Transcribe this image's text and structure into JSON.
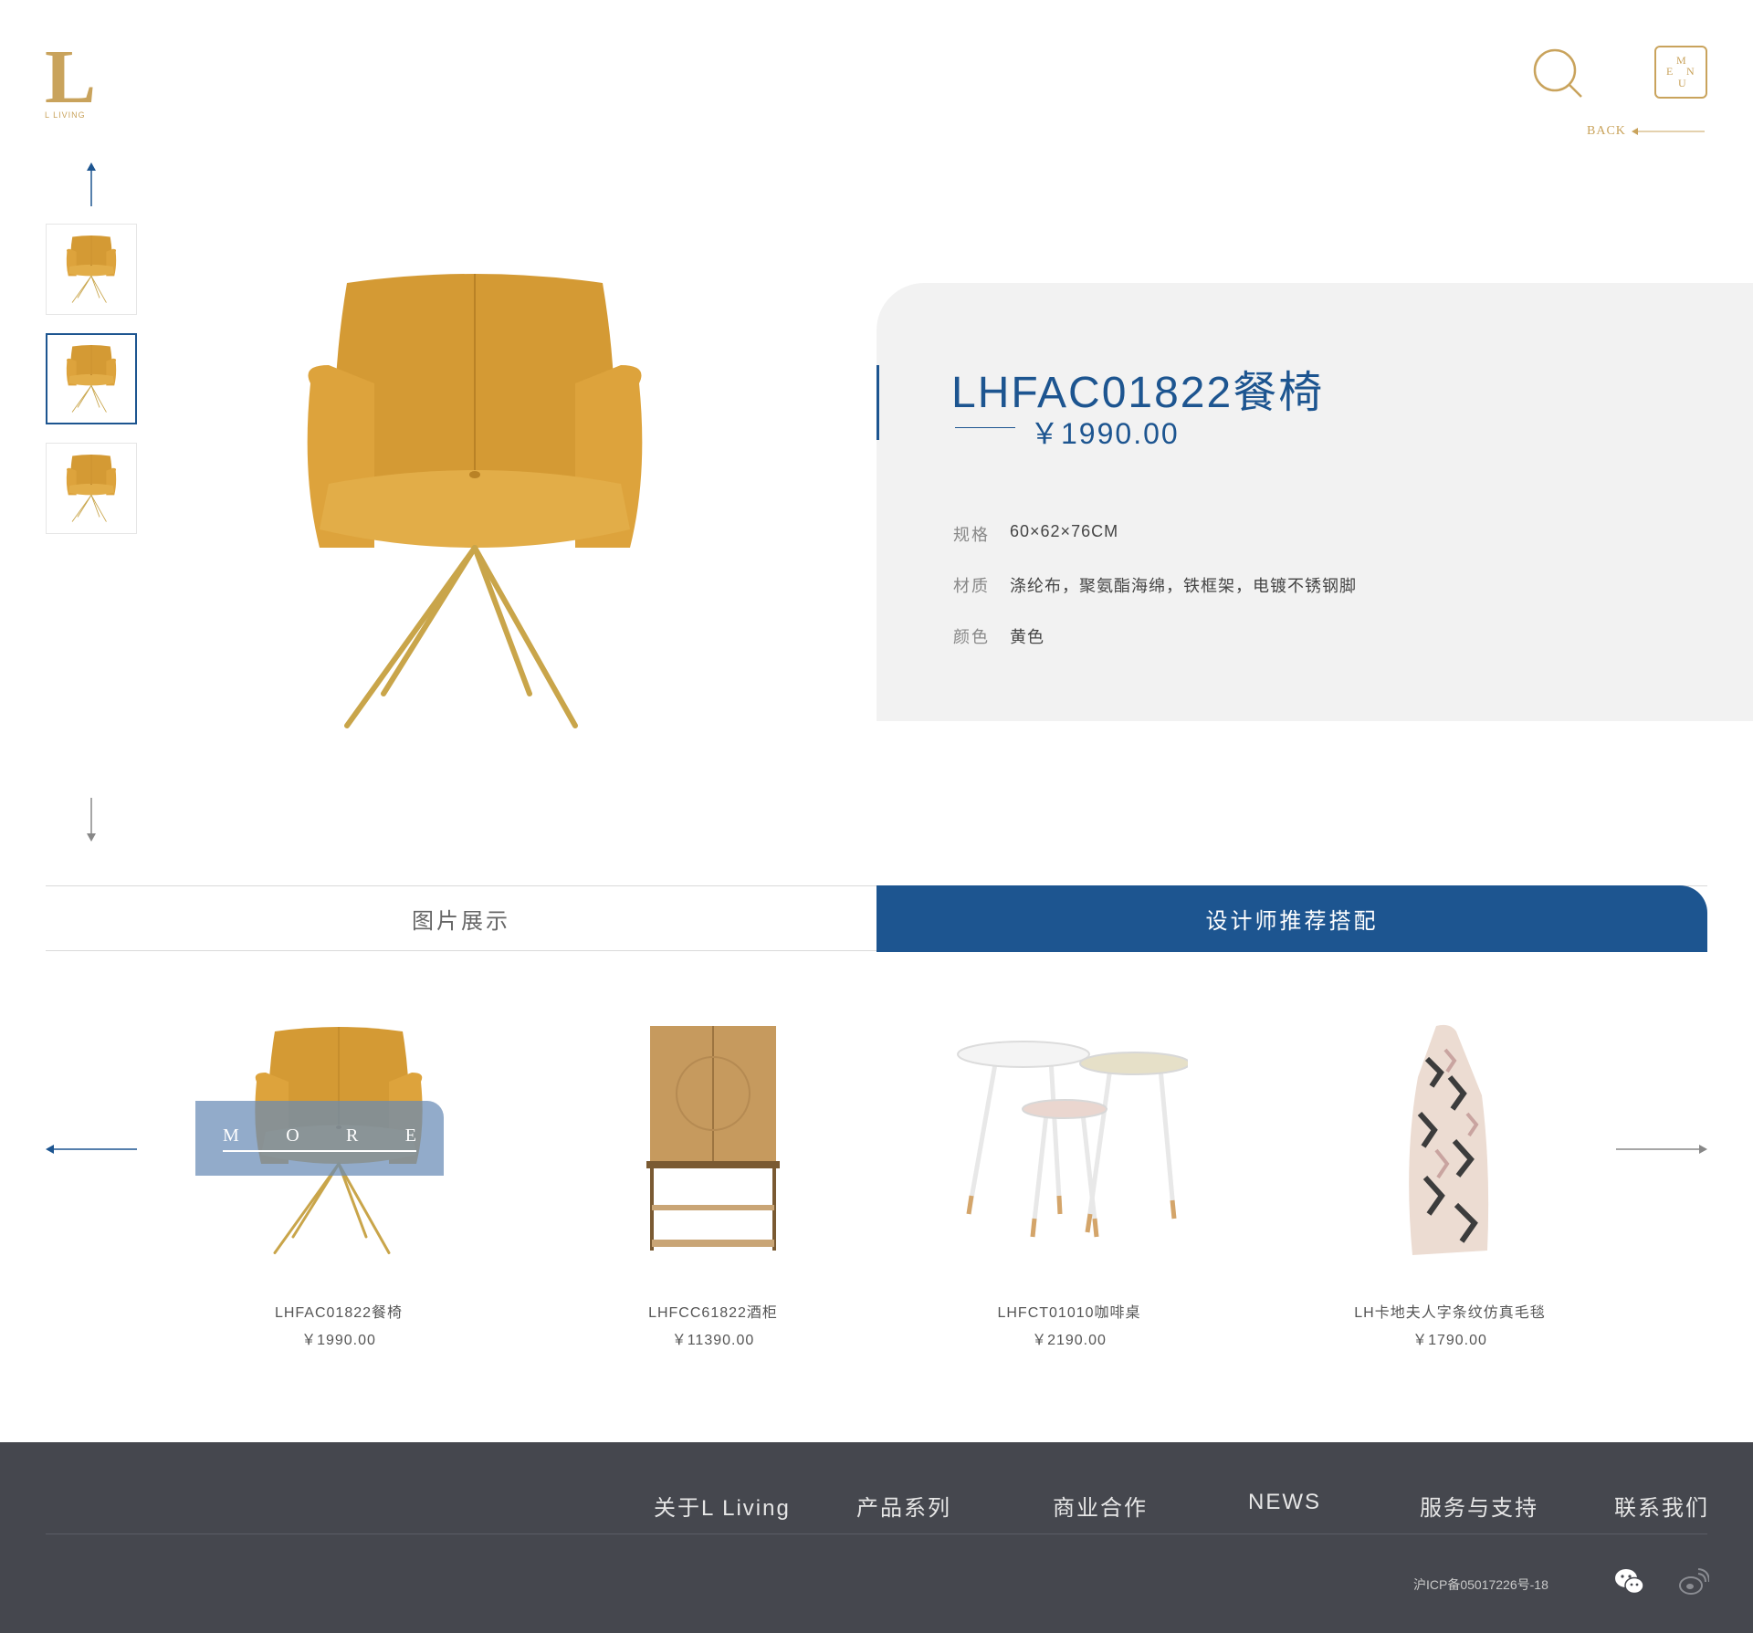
{
  "brand": {
    "logo_letter": "L",
    "logo_sub": "L LIVING"
  },
  "header": {
    "menu_letters": [
      "M",
      "E",
      "N",
      "U"
    ],
    "back_label": "BACK"
  },
  "product": {
    "title": "LHFAC01822餐椅",
    "price": "￥1990.00",
    "specs": [
      {
        "label": "规格",
        "value": "60×62×76CM"
      },
      {
        "label": "材质",
        "value": "涤纶布，聚氨酯海绵，铁框架，电镀不锈钢脚"
      },
      {
        "label": "颜色",
        "value": "黄色"
      }
    ]
  },
  "tabs": [
    {
      "label": "图片展示",
      "active": false
    },
    {
      "label": "设计师推荐搭配",
      "active": true
    }
  ],
  "recommendations": {
    "more_letters": [
      "M",
      "O",
      "R",
      "E"
    ],
    "items": [
      {
        "name": "LHFAC01822餐椅",
        "price": "￥1990.00"
      },
      {
        "name": "LHFCC61822酒柜",
        "price": "￥11390.00"
      },
      {
        "name": "LHFCT01010咖啡桌",
        "price": "￥2190.00"
      },
      {
        "name": "LH卡地夫人字条纹仿真毛毯",
        "price": "￥1790.00"
      }
    ]
  },
  "footer": {
    "nav": [
      "关于L Living",
      "产品系列",
      "商业合作",
      "NEWS",
      "服务与支持",
      "联系我们"
    ],
    "icp": "沪ICP备05017226号-18"
  },
  "colors": {
    "accent_blue": "#1d5590",
    "gold": "#c9a35c",
    "panel_gray": "#f2f2f2",
    "footer_bg": "#45474e"
  }
}
